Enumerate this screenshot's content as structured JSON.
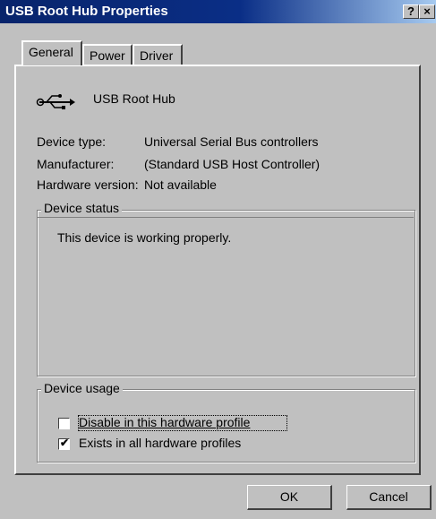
{
  "window": {
    "title": "USB Root Hub Properties",
    "help_button": "?",
    "close_button": "×"
  },
  "tabs": [
    {
      "label": "General"
    },
    {
      "label": "Power"
    },
    {
      "label": "Driver"
    }
  ],
  "device": {
    "name": "USB Root Hub",
    "icon": "usb-icon",
    "fields": [
      {
        "label": "Device type:",
        "value": "Universal Serial Bus controllers"
      },
      {
        "label": "Manufacturer:",
        "value": "(Standard USB Host Controller)"
      },
      {
        "label": "Hardware version:",
        "value": "Not available"
      }
    ]
  },
  "device_status": {
    "title": "Device status",
    "text": "This device is working properly."
  },
  "device_usage": {
    "title": "Device usage",
    "options": [
      {
        "label": "Disable in this hardware profile",
        "checked": false
      },
      {
        "label": "Exists in all hardware profiles",
        "checked": true
      }
    ]
  },
  "buttons": {
    "ok": "OK",
    "cancel": "Cancel"
  }
}
